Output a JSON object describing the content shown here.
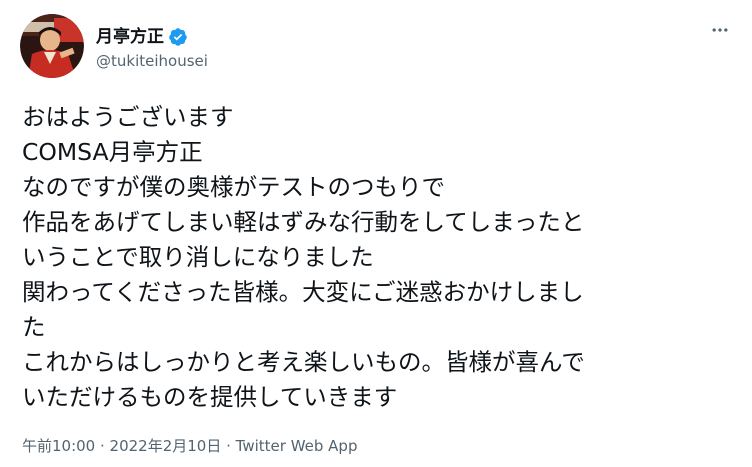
{
  "tweet": {
    "author": {
      "display_name": "月亭方正",
      "handle": "@tukiteihousei",
      "verified": true,
      "verified_icon": "verified-badge-icon",
      "avatar_icon": "profile-avatar"
    },
    "more_icon": "more-options-icon",
    "text": "おはようございます\nCOMSA月亭方正\nなのですが僕の奥様がテストのつもりで\n作品をあげてしまい軽はずみな行動をしてしまったと\nいうことで取り消しになりました\n関わってくださった皆様。大変にご迷惑おかけしまし\nた\nこれからはしっかりと考え楽しいもの。皆様が喜んで\nいただけるものを提供していきます",
    "timestamp": "午前10:00 · 2022年2月10日",
    "separator": " · ",
    "source": "Twitter Web App"
  },
  "colors": {
    "text_primary": "#0f1419",
    "text_secondary": "#536471",
    "verified_blue": "#1d9bf0",
    "background": "#ffffff"
  }
}
